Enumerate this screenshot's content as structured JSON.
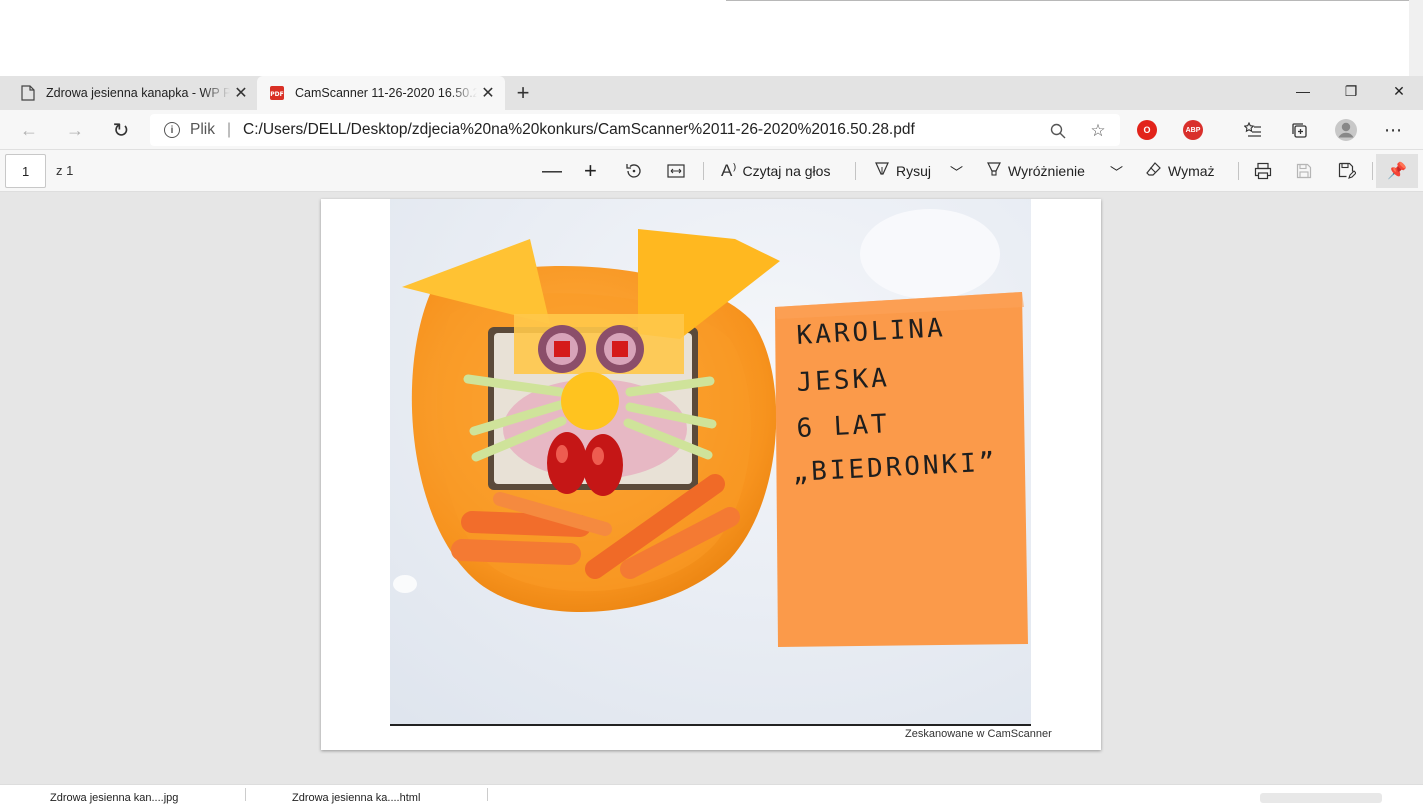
{
  "tabs": [
    {
      "title": "Zdrowa jesienna kanapka - WP Poczta",
      "icon": "document-icon",
      "active": false
    },
    {
      "title": "CamScanner 11-26-2020 16.50.28.pdf",
      "icon": "pdf-icon",
      "active": true
    }
  ],
  "window": {
    "minimize": "—",
    "restore": "❐",
    "close": "✕"
  },
  "address": {
    "scheme_label": "Plik",
    "url": "C:/Users/DELL/Desktop/zdjecia%20na%20konkurs/CamScanner%2011-26-2020%2016.50.28.pdf"
  },
  "pdf_toolbar": {
    "page_number": "1",
    "page_total": "z 1",
    "read_aloud": "Czytaj na głos",
    "draw": "Rysuj",
    "highlight": "Wyróżnienie",
    "erase": "Wymaż"
  },
  "document": {
    "note_lines": [
      "KAROLINA",
      "JESKA",
      "6 LAT",
      "„BIEDRONKI”"
    ],
    "watermark": "Zeskanowane w CamScanner"
  },
  "downloads": [
    {
      "name": "Zdrowa jesienna kan....jpg"
    },
    {
      "name": "Zdrowa jesienna ka....html"
    }
  ],
  "colors": {
    "plate": "#f7931e",
    "note": "#fb9a4a",
    "cheese": "#ffc233",
    "carrot": "#f26d2b"
  }
}
